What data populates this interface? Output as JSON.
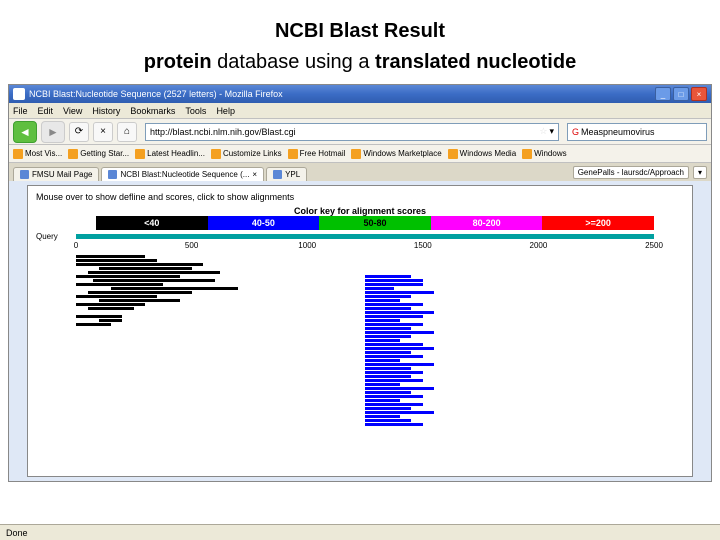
{
  "slide": {
    "title": "NCBI Blast Result",
    "subtitle_plain1": "protein",
    "subtitle_plain2": " database using a ",
    "subtitle_bold": "translated nucleotide"
  },
  "titlebar": {
    "text": "NCBI Blast:Nucleotide Sequence (2527 letters) - Mozilla Firefox",
    "min": "_",
    "max": "□",
    "close": "×"
  },
  "menu": {
    "file": "File",
    "edit": "Edit",
    "view": "View",
    "history": "History",
    "bookmarks": "Bookmarks",
    "tools": "Tools",
    "help": "Help"
  },
  "toolbar": {
    "back": "◄",
    "fwd": "►",
    "reload": "⟳",
    "stop": "×",
    "home": "⌂",
    "url": "http://blast.ncbi.nlm.nih.gov/Blast.cgi",
    "dropdown": "▾",
    "search_placeholder": "Measpneumovirus"
  },
  "bookmarks": {
    "b0": "Most Vis...",
    "b1": "Getting Star...",
    "b2": "Latest Headlin...",
    "b3": "Customize Links",
    "b4": "Free Hotmail",
    "b5": "Windows Marketplace",
    "b6": "Windows Media",
    "b7": "Windows"
  },
  "tabs": {
    "t0": "FMSU Mail Page",
    "t1": "NCBI Blast:Nucleotide Sequence (...",
    "t2": "YPL",
    "ext1": "GenePalls - laursdc/Approach",
    "close": "×"
  },
  "content": {
    "hint": "Mouse over to show defline and scores, click to show alignments",
    "color_key_title": "Color key for alignment scores",
    "ck0": "<40",
    "ck1": "40-50",
    "ck2": "50-80",
    "ck3": "80-200",
    "ck4": ">=200",
    "query_label": "Query",
    "ticks": [
      "0",
      "500",
      "1000",
      "1500",
      "2000",
      "2500"
    ]
  },
  "colors": {
    "ck0": "#000000",
    "ck1": "#0000ff",
    "ck2": "#00c000",
    "ck3": "#ff00ff",
    "ck4": "#ff0000"
  },
  "alignments": [
    [
      [
        0,
        12,
        "#000"
      ]
    ],
    [
      [
        0,
        14,
        "#000"
      ]
    ],
    [
      [
        0,
        22,
        "#000"
      ]
    ],
    [
      [
        4,
        20,
        "#000"
      ]
    ],
    [
      [
        2,
        25,
        "#000"
      ]
    ],
    [
      [
        0,
        18,
        "#000"
      ],
      [
        50,
        58,
        "#00f"
      ]
    ],
    [
      [
        3,
        24,
        "#000"
      ],
      [
        50,
        60,
        "#00f"
      ]
    ],
    [
      [
        0,
        15,
        "#000"
      ],
      [
        50,
        60,
        "#00f"
      ]
    ],
    [
      [
        6,
        28,
        "#000"
      ],
      [
        50,
        55,
        "#00f"
      ]
    ],
    [
      [
        2,
        20,
        "#000"
      ],
      [
        50,
        62,
        "#00f"
      ]
    ],
    [
      [
        0,
        14,
        "#000"
      ],
      [
        50,
        58,
        "#00f"
      ]
    ],
    [
      [
        4,
        18,
        "#000"
      ],
      [
        50,
        56,
        "#00f"
      ]
    ],
    [
      [
        0,
        12,
        "#000"
      ],
      [
        50,
        60,
        "#00f"
      ]
    ],
    [
      [
        2,
        10,
        "#000"
      ],
      [
        50,
        58,
        "#00f"
      ]
    ],
    [
      [
        50,
        62,
        "#00f"
      ]
    ],
    [
      [
        0,
        8,
        "#000"
      ],
      [
        50,
        60,
        "#00f"
      ]
    ],
    [
      [
        4,
        8,
        "#000"
      ],
      [
        50,
        56,
        "#00f"
      ]
    ],
    [
      [
        0,
        6,
        "#000"
      ],
      [
        50,
        60,
        "#00f"
      ]
    ],
    [
      [
        50,
        58,
        "#00f"
      ]
    ],
    [
      [
        50,
        62,
        "#00f"
      ]
    ],
    [
      [
        50,
        58,
        "#00f"
      ]
    ],
    [
      [
        50,
        56,
        "#00f"
      ]
    ],
    [
      [
        50,
        60,
        "#00f"
      ]
    ],
    [
      [
        50,
        62,
        "#00f"
      ]
    ],
    [
      [
        50,
        58,
        "#00f"
      ]
    ],
    [
      [
        50,
        60,
        "#00f"
      ]
    ],
    [
      [
        50,
        56,
        "#00f"
      ]
    ],
    [
      [
        50,
        62,
        "#00f"
      ]
    ],
    [
      [
        50,
        58,
        "#00f"
      ]
    ],
    [
      [
        50,
        60,
        "#00f"
      ]
    ],
    [
      [
        50,
        58,
        "#00f"
      ]
    ],
    [
      [
        50,
        60,
        "#00f"
      ]
    ],
    [
      [
        50,
        56,
        "#00f"
      ]
    ],
    [
      [
        50,
        62,
        "#00f"
      ]
    ],
    [
      [
        50,
        58,
        "#00f"
      ]
    ],
    [
      [
        50,
        60,
        "#00f"
      ]
    ],
    [
      [
        50,
        56,
        "#00f"
      ]
    ],
    [
      [
        50,
        60,
        "#00f"
      ]
    ],
    [
      [
        50,
        58,
        "#00f"
      ]
    ],
    [
      [
        50,
        62,
        "#00f"
      ]
    ],
    [
      [
        50,
        56,
        "#00f"
      ]
    ],
    [
      [
        50,
        58,
        "#00f"
      ]
    ],
    [
      [
        50,
        60,
        "#00f"
      ]
    ]
  ],
  "status": {
    "text": "Done"
  }
}
